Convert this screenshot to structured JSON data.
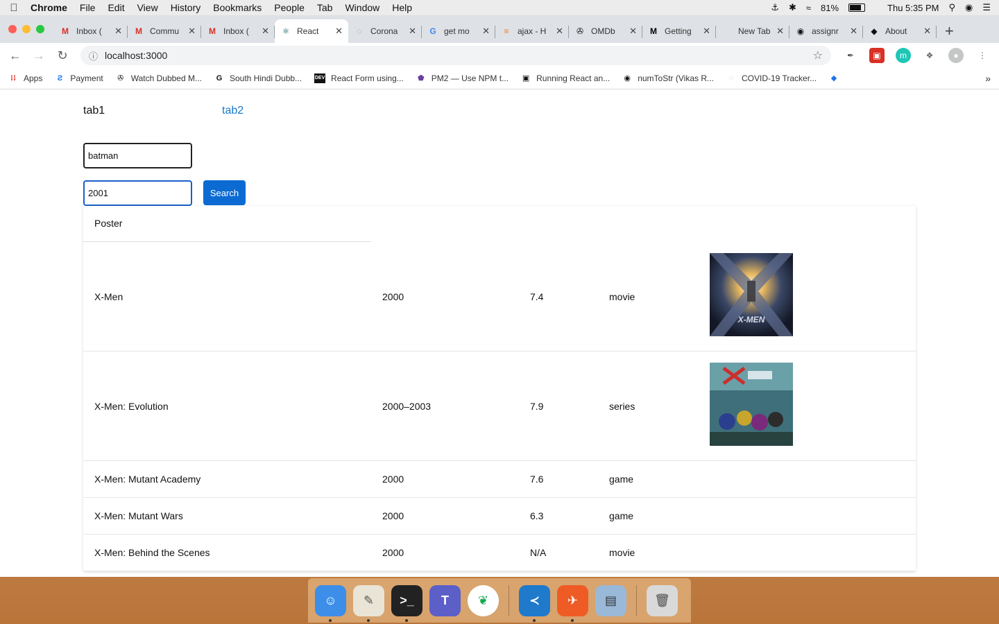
{
  "menubar": {
    "app_name": "Chrome",
    "items": [
      "File",
      "Edit",
      "View",
      "History",
      "Bookmarks",
      "People",
      "Tab",
      "Window",
      "Help"
    ],
    "battery_percent": "81%",
    "clock": "Thu 5:35 PM"
  },
  "browser": {
    "tabs": [
      {
        "title": "Inbox (",
        "icon": "gmail-icon",
        "glyph": "M",
        "color": "#d93025"
      },
      {
        "title": "Commu",
        "icon": "gmail-icon",
        "glyph": "M",
        "color": "#d93025"
      },
      {
        "title": "Inbox (",
        "icon": "gmail-icon",
        "glyph": "M",
        "color": "#d93025"
      },
      {
        "title": "React",
        "icon": "react-icon",
        "glyph": "⚛",
        "color": "#0b5c5c",
        "active": true
      },
      {
        "title": "Corona",
        "icon": "globe-icon",
        "glyph": "◌",
        "color": "#999"
      },
      {
        "title": "get mo",
        "icon": "google-icon",
        "glyph": "G",
        "color": "#4285f4"
      },
      {
        "title": "ajax - H",
        "icon": "stackoverflow-icon",
        "glyph": "≡",
        "color": "#f48024"
      },
      {
        "title": "OMDb",
        "icon": "film-reel-icon",
        "glyph": "✇",
        "color": "#111"
      },
      {
        "title": "Getting",
        "icon": "medium-icon",
        "glyph": "M",
        "color": "#000"
      },
      {
        "title": "New Tab",
        "icon": "",
        "glyph": "",
        "color": "#000"
      },
      {
        "title": "assignr",
        "icon": "github-icon",
        "glyph": "◉",
        "color": "#111"
      },
      {
        "title": "About",
        "icon": "batman-icon",
        "glyph": "◆",
        "color": "#111"
      }
    ],
    "url": "localhost:3000",
    "bookmarks": [
      {
        "label": "Apps",
        "icon": "apps-grid-icon",
        "glyph": "⁝⁝",
        "color": "#e8453c"
      },
      {
        "label": "Payment",
        "icon": "payment-icon",
        "glyph": "Ƨ",
        "color": "#1a73e8"
      },
      {
        "label": "Watch Dubbed M...",
        "icon": "film-reel-icon",
        "glyph": "✇",
        "color": "#111"
      },
      {
        "label": "South Hindi Dubb...",
        "icon": "g-circle-icon",
        "glyph": "G",
        "color": "#111"
      },
      {
        "label": "React Form using...",
        "icon": "dev-icon",
        "glyph": "DEV",
        "color": "#111"
      },
      {
        "label": "PM2 — Use NPM t...",
        "icon": "pm2-icon",
        "glyph": "⬟",
        "color": "#6b3fa0"
      },
      {
        "label": "Running React an...",
        "icon": "dockerize-icon",
        "glyph": "▣",
        "color": "#111"
      },
      {
        "label": "numToStr (Vikas R...",
        "icon": "github-icon",
        "glyph": "◉",
        "color": "#111"
      },
      {
        "label": "COVID-19 Tracker...",
        "icon": "globe-icon",
        "glyph": "◌",
        "color": "#bbb"
      },
      {
        "label": "",
        "icon": "diamond-icon",
        "glyph": "◆",
        "color": "#1a73e8"
      }
    ]
  },
  "page": {
    "tab1_label": "tab1",
    "tab2_label": "tab2",
    "title_input_value": "batman",
    "year_input_value": "2001",
    "search_button_label": "Search",
    "table_header": "Poster",
    "rows": [
      {
        "title": "X-Men",
        "year": "2000",
        "rating": "7.4",
        "type": "movie",
        "poster": "xmen"
      },
      {
        "title": "X-Men: Evolution",
        "year": "2000–2003",
        "rating": "7.9",
        "type": "series",
        "poster": "evolution"
      },
      {
        "title": "X-Men: Mutant Academy",
        "year": "2000",
        "rating": "7.6",
        "type": "game",
        "poster": null
      },
      {
        "title": "X-Men: Mutant Wars",
        "year": "2000",
        "rating": "6.3",
        "type": "game",
        "poster": null
      },
      {
        "title": "X-Men: Behind the Scenes",
        "year": "2000",
        "rating": "N/A",
        "type": "movie",
        "poster": null
      }
    ]
  },
  "dock": [
    {
      "name": "finder-icon",
      "glyph": "☺",
      "bg": "#3d8ee8",
      "fg": "#fff",
      "running": true
    },
    {
      "name": "textedit-icon",
      "glyph": "✎",
      "bg": "#e9e4d6",
      "fg": "#555",
      "running": true
    },
    {
      "name": "terminal-icon",
      "glyph": ">_",
      "bg": "#222",
      "fg": "#eee",
      "running": true
    },
    {
      "name": "teams-icon",
      "glyph": "T",
      "bg": "#5b5fc7",
      "fg": "#fff",
      "running": false
    },
    {
      "name": "mongodb-compass-icon",
      "glyph": "❦",
      "bg": "#fff",
      "fg": "#13aa52",
      "running": false
    },
    {
      "name": "vscode-icon",
      "glyph": "≺",
      "bg": "#1f7acc",
      "fg": "#fff",
      "running": true
    },
    {
      "name": "postman-icon",
      "glyph": "✈",
      "bg": "#ef5b25",
      "fg": "#fff",
      "running": true
    },
    {
      "name": "preview-icon",
      "glyph": "▤",
      "bg": "#9ab9d8",
      "fg": "#333",
      "running": false
    },
    {
      "name": "trash-icon",
      "glyph": "🗑",
      "bg": "#d9d9d9",
      "fg": "#777",
      "running": false
    }
  ]
}
